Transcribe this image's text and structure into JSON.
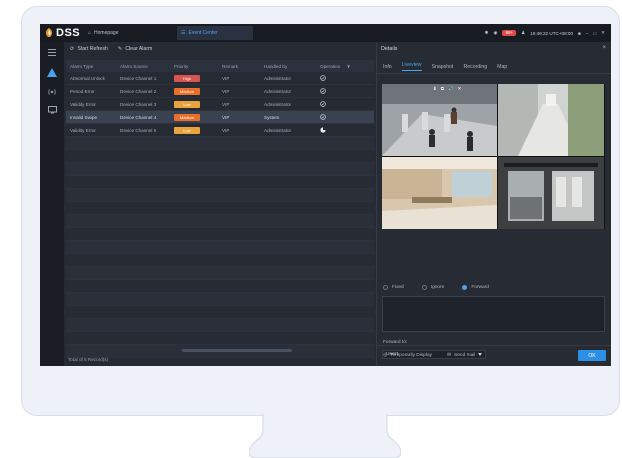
{
  "app": {
    "logo_text": "DSS"
  },
  "tabs": [
    {
      "label": "Homepage",
      "icon": "home-icon"
    },
    {
      "label": "Event Center",
      "icon": "list-icon"
    }
  ],
  "status_bar": {
    "alarm_count": "99+",
    "user": "admin",
    "time": "16:49:22 UTC+08:00"
  },
  "toolbar": {
    "start_refresh": "Start Refresh",
    "clear_alarm": "Clear Alarm"
  },
  "table": {
    "headers": [
      "Alarm Type",
      "Alarm Source",
      "Priority",
      "Remark",
      "Handled by",
      "Operation"
    ],
    "rows": [
      {
        "type": "Abnormal Unlock",
        "source": "Device Channel 1",
        "priority": "High",
        "remark": "VIP",
        "handler": "Administrator",
        "selected": false
      },
      {
        "type": "Period Error",
        "source": "Device Channel 2",
        "priority": "Medium",
        "remark": "VIP",
        "handler": "Administrator",
        "selected": false
      },
      {
        "type": "Validity Error",
        "source": "Device Channel 3",
        "priority": "Low",
        "remark": "VIP",
        "handler": "Administrator",
        "selected": false
      },
      {
        "type": "Invalid Swipe",
        "source": "Device Channel 4",
        "priority": "Medium",
        "remark": "VIP",
        "handler": "System",
        "selected": true
      },
      {
        "type": "Validity Error",
        "source": "Device Channel 5",
        "priority": "Low",
        "remark": "VIP",
        "handler": "Administrator",
        "selected": false
      }
    ],
    "footer": "Total of 5 Record(s)"
  },
  "details": {
    "title": "Details",
    "tabs": [
      "Info",
      "Liveview",
      "Snapshot",
      "Recording",
      "Map"
    ],
    "active_tab": "Liveview",
    "cam_tools": [
      "⬇",
      "⧉",
      "🔊",
      "✕"
    ],
    "actions": [
      "Fixed",
      "Ignore",
      "Forward"
    ],
    "selected_action": "Forward",
    "forward_label": "Forward to:",
    "forward_value": "User1",
    "option_temp": "Temporarily Display",
    "option_sms": "Send mail",
    "ok_label": "OK"
  },
  "colors": {
    "accent": "#2b8fe6",
    "high": "#d9534f",
    "medium": "#e8702a",
    "low": "#e8a33d"
  }
}
